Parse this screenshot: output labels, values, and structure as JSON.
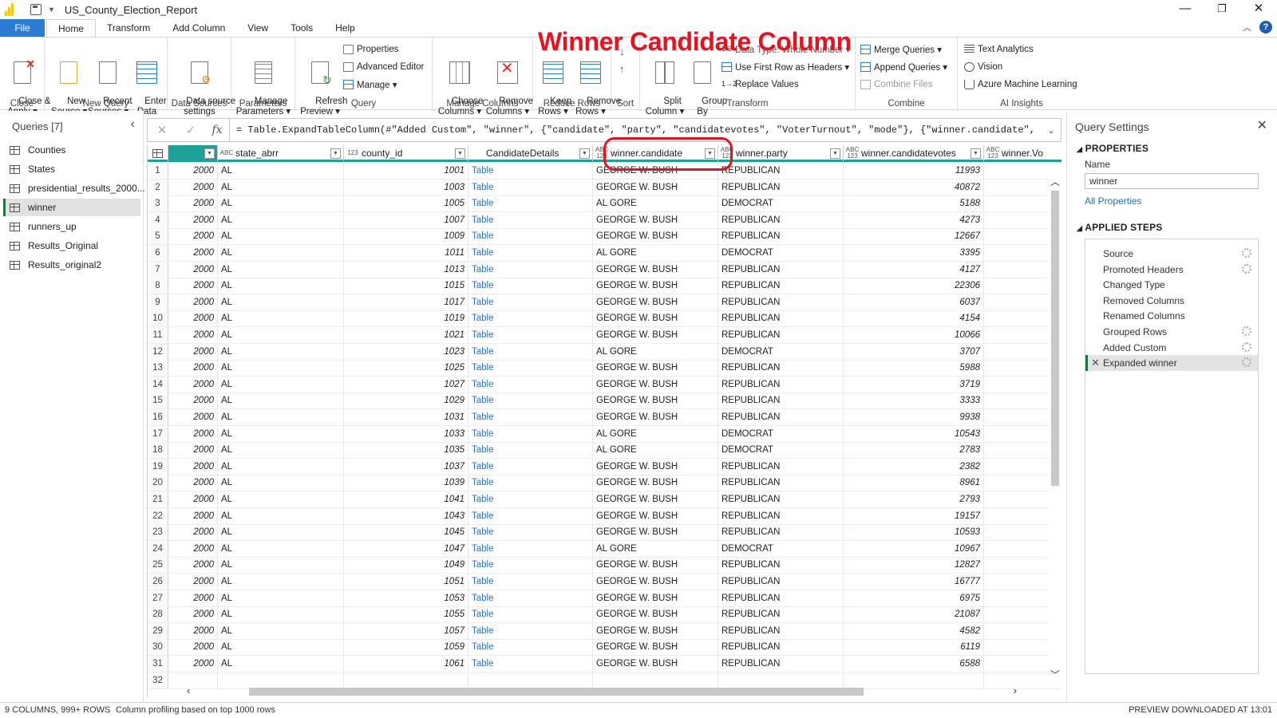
{
  "window": {
    "title": "US_County_Election_Report",
    "minimize": "—",
    "maximize": "❐",
    "close": "✕"
  },
  "tabs": [
    "File",
    "Home",
    "Transform",
    "Add Column",
    "View",
    "Tools",
    "Help"
  ],
  "ribbon": {
    "close_apply": "Close &\nApply ▾",
    "group_close": "Close",
    "new_source": "New\nSource ▾",
    "recent_sources": "Recent\nSources ▾",
    "enter_data": "Enter\nData",
    "group_new_query": "New Query",
    "data_source_settings": "Data source\nsettings",
    "group_data_sources": "Data Sources",
    "manage_parameters": "Manage\nParameters ▾",
    "group_parameters": "Parameters",
    "refresh_preview": "Refresh\nPreview ▾",
    "properties": "Properties",
    "advanced_editor": "Advanced Editor",
    "manage": "Manage ▾",
    "group_query": "Query",
    "choose_columns": "Choose\nColumns ▾",
    "remove_columns": "Remove\nColumns ▾",
    "group_manage_columns": "Manage Columns",
    "keep_rows": "Keep\nRows ▾",
    "remove_rows": "Remove\nRows ▾",
    "group_reduce_rows": "Reduce Rows",
    "group_sort": "Sort",
    "split_column": "Split\nColumn ▾",
    "group_by": "Group\nBy",
    "data_type": "Data Type: Whole Number ▾",
    "first_row_headers": "Use First Row as Headers ▾",
    "replace_values": "Replace Values",
    "group_transform": "Transform",
    "merge_queries": "Merge Queries ▾",
    "append_queries": "Append Queries ▾",
    "combine_files": "Combine Files",
    "group_combine": "Combine",
    "text_analytics": "Text Analytics",
    "vision": "Vision",
    "azure_ml": "Azure Machine Learning",
    "group_ai": "AI Insights"
  },
  "queries": {
    "header": "Queries [7]",
    "items": [
      "Counties",
      "States",
      "presidential_results_2000...",
      "winner",
      "runners_up",
      "Results_Original",
      "Results_original2"
    ],
    "selected": 3
  },
  "formula": "= Table.ExpandTableColumn(#\"Added Custom\", \"winner\", {\"candidate\", \"party\", \"candidatevotes\", \"VoterTurnout\", \"mode\"}, {\"winner.candidate\",",
  "columns": [
    {
      "type": "",
      "name": ""
    },
    {
      "type": "ABC",
      "name": "state_abrr"
    },
    {
      "type": "123",
      "name": "county_id"
    },
    {
      "type": "",
      "name": "CandidateDetails"
    },
    {
      "type": "ABC\n123",
      "name": "winner.candidate"
    },
    {
      "type": "ABC\n123",
      "name": "winner.party"
    },
    {
      "type": "ABC\n123",
      "name": "winner.candidatevotes"
    },
    {
      "type": "ABC\n123",
      "name": "winner.Vo"
    }
  ],
  "rows": [
    [
      "1",
      "2000",
      "AL",
      "1001",
      "Table",
      "GEORGE W. BUSH",
      "REPUBLICAN",
      "11993"
    ],
    [
      "2",
      "2000",
      "AL",
      "1003",
      "Table",
      "GEORGE W. BUSH",
      "REPUBLICAN",
      "40872"
    ],
    [
      "3",
      "2000",
      "AL",
      "1005",
      "Table",
      "AL GORE",
      "DEMOCRAT",
      "5188"
    ],
    [
      "4",
      "2000",
      "AL",
      "1007",
      "Table",
      "GEORGE W. BUSH",
      "REPUBLICAN",
      "4273"
    ],
    [
      "5",
      "2000",
      "AL",
      "1009",
      "Table",
      "GEORGE W. BUSH",
      "REPUBLICAN",
      "12667"
    ],
    [
      "6",
      "2000",
      "AL",
      "1011",
      "Table",
      "AL GORE",
      "DEMOCRAT",
      "3395"
    ],
    [
      "7",
      "2000",
      "AL",
      "1013",
      "Table",
      "GEORGE W. BUSH",
      "REPUBLICAN",
      "4127"
    ],
    [
      "8",
      "2000",
      "AL",
      "1015",
      "Table",
      "GEORGE W. BUSH",
      "REPUBLICAN",
      "22306"
    ],
    [
      "9",
      "2000",
      "AL",
      "1017",
      "Table",
      "GEORGE W. BUSH",
      "REPUBLICAN",
      "6037"
    ],
    [
      "10",
      "2000",
      "AL",
      "1019",
      "Table",
      "GEORGE W. BUSH",
      "REPUBLICAN",
      "4154"
    ],
    [
      "11",
      "2000",
      "AL",
      "1021",
      "Table",
      "GEORGE W. BUSH",
      "REPUBLICAN",
      "10066"
    ],
    [
      "12",
      "2000",
      "AL",
      "1023",
      "Table",
      "AL GORE",
      "DEMOCRAT",
      "3707"
    ],
    [
      "13",
      "2000",
      "AL",
      "1025",
      "Table",
      "GEORGE W. BUSH",
      "REPUBLICAN",
      "5988"
    ],
    [
      "14",
      "2000",
      "AL",
      "1027",
      "Table",
      "GEORGE W. BUSH",
      "REPUBLICAN",
      "3719"
    ],
    [
      "15",
      "2000",
      "AL",
      "1029",
      "Table",
      "GEORGE W. BUSH",
      "REPUBLICAN",
      "3333"
    ],
    [
      "16",
      "2000",
      "AL",
      "1031",
      "Table",
      "GEORGE W. BUSH",
      "REPUBLICAN",
      "9938"
    ],
    [
      "17",
      "2000",
      "AL",
      "1033",
      "Table",
      "AL GORE",
      "DEMOCRAT",
      "10543"
    ],
    [
      "18",
      "2000",
      "AL",
      "1035",
      "Table",
      "AL GORE",
      "DEMOCRAT",
      "2783"
    ],
    [
      "19",
      "2000",
      "AL",
      "1037",
      "Table",
      "GEORGE W. BUSH",
      "REPUBLICAN",
      "2382"
    ],
    [
      "20",
      "2000",
      "AL",
      "1039",
      "Table",
      "GEORGE W. BUSH",
      "REPUBLICAN",
      "8961"
    ],
    [
      "21",
      "2000",
      "AL",
      "1041",
      "Table",
      "GEORGE W. BUSH",
      "REPUBLICAN",
      "2793"
    ],
    [
      "22",
      "2000",
      "AL",
      "1043",
      "Table",
      "GEORGE W. BUSH",
      "REPUBLICAN",
      "19157"
    ],
    [
      "23",
      "2000",
      "AL",
      "1045",
      "Table",
      "GEORGE W. BUSH",
      "REPUBLICAN",
      "10593"
    ],
    [
      "24",
      "2000",
      "AL",
      "1047",
      "Table",
      "AL GORE",
      "DEMOCRAT",
      "10967"
    ],
    [
      "25",
      "2000",
      "AL",
      "1049",
      "Table",
      "GEORGE W. BUSH",
      "REPUBLICAN",
      "12827"
    ],
    [
      "26",
      "2000",
      "AL",
      "1051",
      "Table",
      "GEORGE W. BUSH",
      "REPUBLICAN",
      "16777"
    ],
    [
      "27",
      "2000",
      "AL",
      "1053",
      "Table",
      "GEORGE W. BUSH",
      "REPUBLICAN",
      "6975"
    ],
    [
      "28",
      "2000",
      "AL",
      "1055",
      "Table",
      "GEORGE W. BUSH",
      "REPUBLICAN",
      "21087"
    ],
    [
      "29",
      "2000",
      "AL",
      "1057",
      "Table",
      "GEORGE W. BUSH",
      "REPUBLICAN",
      "4582"
    ],
    [
      "30",
      "2000",
      "AL",
      "1059",
      "Table",
      "GEORGE W. BUSH",
      "REPUBLICAN",
      "6119"
    ],
    [
      "31",
      "2000",
      "AL",
      "1061",
      "Table",
      "GEORGE W. BUSH",
      "REPUBLICAN",
      "6588"
    ],
    [
      "32",
      "",
      "",
      "",
      "",
      "",
      "",
      ""
    ]
  ],
  "settings": {
    "title": "Query Settings",
    "properties": "PROPERTIES",
    "name_label": "Name",
    "name_value": "winner",
    "all_properties": "All Properties",
    "applied_steps": "APPLIED STEPS",
    "steps": [
      {
        "name": "Source",
        "gear": true
      },
      {
        "name": "Promoted Headers",
        "gear": true
      },
      {
        "name": "Changed Type",
        "gear": false
      },
      {
        "name": "Removed Columns",
        "gear": false
      },
      {
        "name": "Renamed Columns",
        "gear": false
      },
      {
        "name": "Grouped Rows",
        "gear": true
      },
      {
        "name": "Added Custom",
        "gear": true
      },
      {
        "name": "Expanded winner",
        "gear": true
      }
    ],
    "selected_step": 7
  },
  "status": {
    "left": "9 COLUMNS, 999+ ROWS",
    "profiling": "Column profiling based on top 1000 rows",
    "right": "PREVIEW DOWNLOADED AT 13:01"
  },
  "annotation": "Winner Candidate Column",
  "colors": {
    "accent": "#1ba196",
    "file_tab": "#2b7cd3",
    "annotation": "#e8121e",
    "link": "#2a70c4"
  }
}
